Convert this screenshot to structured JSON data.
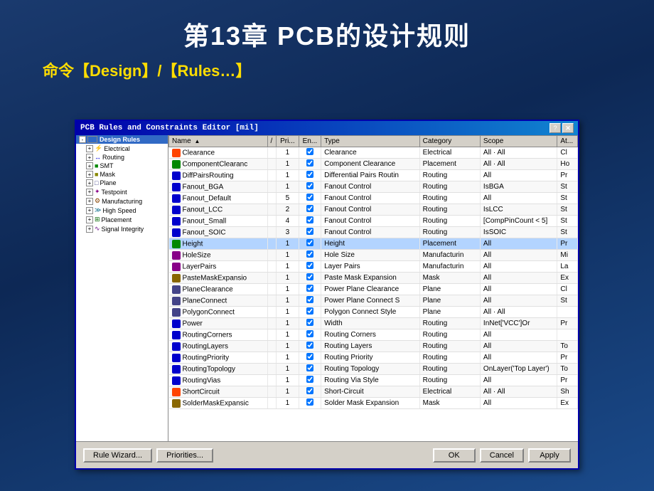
{
  "page": {
    "title": "第13章  PCB的设计规则",
    "subtitle": "命令【Design】/【Rules…】"
  },
  "dialog": {
    "title": "PCB Rules and Constraints Editor [mil]",
    "titlebar_unit": "[mil]",
    "buttons": {
      "help": "?",
      "close": "✕"
    },
    "tree": {
      "root": "Design Rules",
      "items": [
        {
          "label": "Electrical",
          "level": 1,
          "expanded": true
        },
        {
          "label": "Routing",
          "level": 1,
          "expanded": true
        },
        {
          "label": "SMT",
          "level": 1,
          "expanded": false
        },
        {
          "label": "Mask",
          "level": 1,
          "expanded": false
        },
        {
          "label": "Plane",
          "level": 1,
          "expanded": false
        },
        {
          "label": "Testpoint",
          "level": 1,
          "expanded": false
        },
        {
          "label": "Manufacturing",
          "level": 1,
          "expanded": false
        },
        {
          "label": "High Speed",
          "level": 1,
          "expanded": false
        },
        {
          "label": "Placement",
          "level": 1,
          "expanded": false
        },
        {
          "label": "Signal Integrity",
          "level": 1,
          "expanded": false
        }
      ]
    },
    "table": {
      "columns": [
        "Name",
        "/",
        "Pri...",
        "En...",
        "Type",
        "Category",
        "Scope",
        "At..."
      ],
      "rows": [
        {
          "name": "Clearance",
          "pri": "1",
          "en": true,
          "type": "Clearance",
          "cat": "Electrical",
          "scope": "All · All",
          "at": "Cl"
        },
        {
          "name": "ComponentClearanc",
          "pri": "1",
          "en": true,
          "type": "Component Clearance",
          "cat": "Placement",
          "scope": "All · All",
          "at": "Ho"
        },
        {
          "name": "DiffPairsRouting",
          "pri": "1",
          "en": true,
          "type": "Differential Pairs Routin",
          "cat": "Routing",
          "scope": "All",
          "at": "Pr"
        },
        {
          "name": "Fanout_BGA",
          "pri": "1",
          "en": true,
          "type": "Fanout Control",
          "cat": "Routing",
          "scope": "IsBGA",
          "at": "St"
        },
        {
          "name": "Fanout_Default",
          "pri": "5",
          "en": true,
          "type": "Fanout Control",
          "cat": "Routing",
          "scope": "All",
          "at": "St"
        },
        {
          "name": "Fanout_LCC",
          "pri": "2",
          "en": true,
          "type": "Fanout Control",
          "cat": "Routing",
          "scope": "IsLCC",
          "at": "St"
        },
        {
          "name": "Fanout_Small",
          "pri": "4",
          "en": true,
          "type": "Fanout Control",
          "cat": "Routing",
          "scope": "[CompPinCount < 5]",
          "at": "St"
        },
        {
          "name": "Fanout_SOIC",
          "pri": "3",
          "en": true,
          "type": "Fanout Control",
          "cat": "Routing",
          "scope": "IsSOIC",
          "at": "St"
        },
        {
          "name": "Height",
          "pri": "1",
          "en": true,
          "type": "Height",
          "cat": "Placement",
          "scope": "All",
          "at": "Pr"
        },
        {
          "name": "HoleSize",
          "pri": "1",
          "en": true,
          "type": "Hole Size",
          "cat": "Manufacturin",
          "scope": "All",
          "at": "Mi"
        },
        {
          "name": "LayerPairs",
          "pri": "1",
          "en": true,
          "type": "Layer Pairs",
          "cat": "Manufacturin",
          "scope": "All",
          "at": "La"
        },
        {
          "name": "PasteMaskExpansio",
          "pri": "1",
          "en": true,
          "type": "Paste Mask Expansion",
          "cat": "Mask",
          "scope": "All",
          "at": "Ex"
        },
        {
          "name": "PlaneClearance",
          "pri": "1",
          "en": true,
          "type": "Power Plane Clearance",
          "cat": "Plane",
          "scope": "All",
          "at": "Cl"
        },
        {
          "name": "PlaneConnect",
          "pri": "1",
          "en": true,
          "type": "Power Plane Connect S",
          "cat": "Plane",
          "scope": "All",
          "at": "St"
        },
        {
          "name": "PolygonConnect",
          "pri": "1",
          "en": true,
          "type": "Polygon Connect Style",
          "cat": "Plane",
          "scope": "All · All",
          "at": ""
        },
        {
          "name": "Power",
          "pri": "1",
          "en": true,
          "type": "Width",
          "cat": "Routing",
          "scope": "InNet['VCC']Or",
          "at": "Pr"
        },
        {
          "name": "RoutingCorners",
          "pri": "1",
          "en": true,
          "type": "Routing Corners",
          "cat": "Routing",
          "scope": "All",
          "at": ""
        },
        {
          "name": "RoutingLayers",
          "pri": "1",
          "en": true,
          "type": "Routing Layers",
          "cat": "Routing",
          "scope": "All",
          "at": "To"
        },
        {
          "name": "RoutingPriority",
          "pri": "1",
          "en": true,
          "type": "Routing Priority",
          "cat": "Routing",
          "scope": "All",
          "at": "Pr"
        },
        {
          "name": "RoutingTopology",
          "pri": "1",
          "en": true,
          "type": "Routing Topology",
          "cat": "Routing",
          "scope": "OnLayer('Top Layer')",
          "at": "To"
        },
        {
          "name": "RoutingVias",
          "pri": "1",
          "en": true,
          "type": "Routing Via Style",
          "cat": "Routing",
          "scope": "All",
          "at": "Pr"
        },
        {
          "name": "ShortCircuit",
          "pri": "1",
          "en": true,
          "type": "Short-Circuit",
          "cat": "Electrical",
          "scope": "All · All",
          "at": "Sh"
        },
        {
          "name": "SolderMaskExpansic",
          "pri": "1",
          "en": true,
          "type": "Solder Mask Expansion",
          "cat": "Mask",
          "scope": "All",
          "at": "Ex"
        }
      ]
    },
    "footer": {
      "btn_rule_wizard": "Rule Wizard...",
      "btn_priorities": "Priorities...",
      "btn_ok": "OK",
      "btn_cancel": "Cancel",
      "btn_apply": "Apply"
    }
  }
}
